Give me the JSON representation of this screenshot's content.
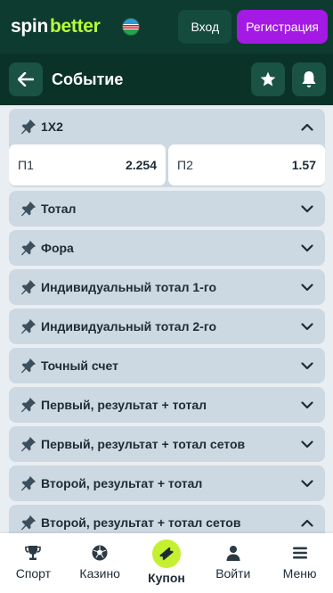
{
  "header": {
    "logo_spin": "spin",
    "logo_better": "better",
    "login_label": "Вход",
    "register_label": "Регистрация"
  },
  "subheader": {
    "title": "Событие"
  },
  "markets": [
    {
      "title": "1X2",
      "expanded": true,
      "odds": [
        {
          "label": "П1",
          "value": "2.254"
        },
        {
          "label": "П2",
          "value": "1.57"
        }
      ]
    },
    {
      "title": "Тотал",
      "expanded": false
    },
    {
      "title": "Фора",
      "expanded": false
    },
    {
      "title": "Индивидуальный тотал 1-го",
      "expanded": false
    },
    {
      "title": "Индивидуальный тотал 2-го",
      "expanded": false
    },
    {
      "title": "Точный счет",
      "expanded": false
    },
    {
      "title": "Первый, результат + тотал",
      "expanded": false
    },
    {
      "title": "Первый, результат + тотал сетов",
      "expanded": false
    },
    {
      "title": "Второй, результат + тотал",
      "expanded": false
    },
    {
      "title": "Второй, результат + тотал сетов",
      "expanded": true
    }
  ],
  "bottom_nav": [
    {
      "label": "Спорт",
      "icon": "trophy-icon"
    },
    {
      "label": "Казино",
      "icon": "soccer-ball-icon"
    },
    {
      "label": "Купон",
      "icon": "ticket-icon"
    },
    {
      "label": "Войти",
      "icon": "user-icon"
    },
    {
      "label": "Меню",
      "icon": "menu-icon"
    }
  ],
  "colors": {
    "header_bg": "#0e3b2f",
    "accent_green": "#b6ff3b",
    "register_purple": "#a419e3",
    "coupon_lime": "#c4f02f",
    "market_bg": "#ccd8e2"
  }
}
